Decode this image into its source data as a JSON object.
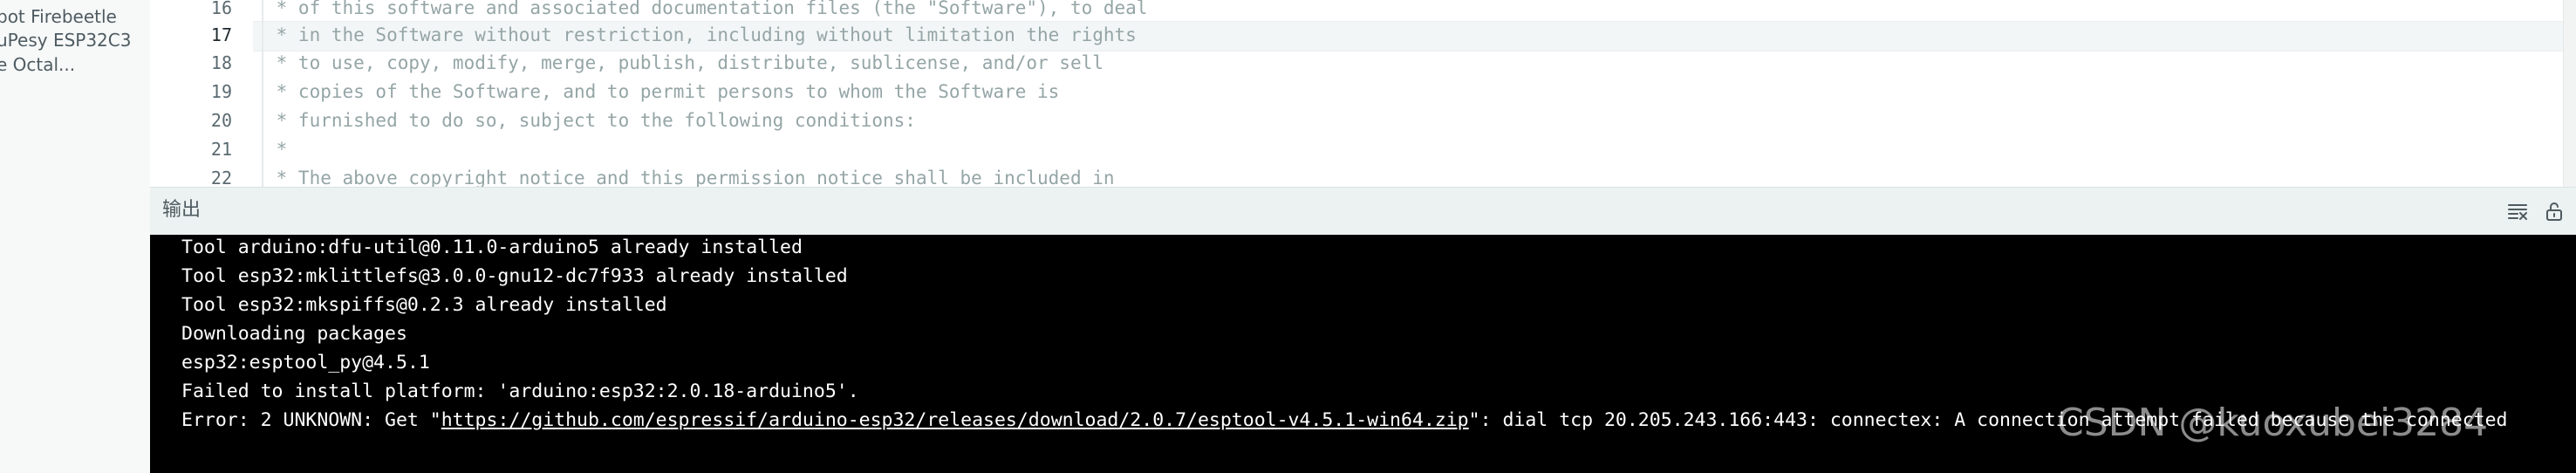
{
  "sidebar": {
    "items": [
      "bot Firebeetle",
      "uPesy ESP32C3",
      "e Octal..."
    ]
  },
  "editor": {
    "current_line": "17",
    "lines": [
      {
        "num": "16",
        "text": " * of this software and associated documentation files (the \"Software\"), to deal"
      },
      {
        "num": "17",
        "text": " * in the Software without restriction, including without limitation the rights"
      },
      {
        "num": "18",
        "text": " * to use, copy, modify, merge, publish, distribute, sublicense, and/or sell"
      },
      {
        "num": "19",
        "text": " * copies of the Software, and to permit persons to whom the Software is"
      },
      {
        "num": "20",
        "text": " * furnished to do so, subject to the following conditions:"
      },
      {
        "num": "21",
        "text": " *"
      },
      {
        "num": "22",
        "text": " * The above copyright notice and this permission notice shall be included in"
      }
    ]
  },
  "output": {
    "title": "输出",
    "clear_icon": "clear-output-icon",
    "lock_icon": "unlock-scroll-icon",
    "lines": [
      "Tool arduino:dfu-util@0.11.0-arduino5 already installed",
      "Tool esp32:mklittlefs@3.0.0-gnu12-dc7f933 already installed",
      "Tool esp32:mkspiffs@0.2.3 already installed",
      "Downloading packages",
      "esp32:esptool_py@4.5.1",
      "Failed to install platform: 'arduino:esp32:2.0.18-arduino5'."
    ],
    "error": {
      "prefix": "Error: 2 UNKNOWN: Get \"",
      "url": "https://github.com/espressif/arduino-esp32/releases/download/2.0.7/esptool-v4.5.1-win64.zip",
      "suffix": "\": dial tcp 20.205.243.166:443: connectex: A connection attempt failed because the connected"
    }
  },
  "watermark": "CSDN @kuoxubei3284",
  "colors": {
    "console_bg": "#000000",
    "console_text": "#ffffff",
    "comment": "#95a5a6",
    "output_header_bg": "#ecf1f1"
  }
}
